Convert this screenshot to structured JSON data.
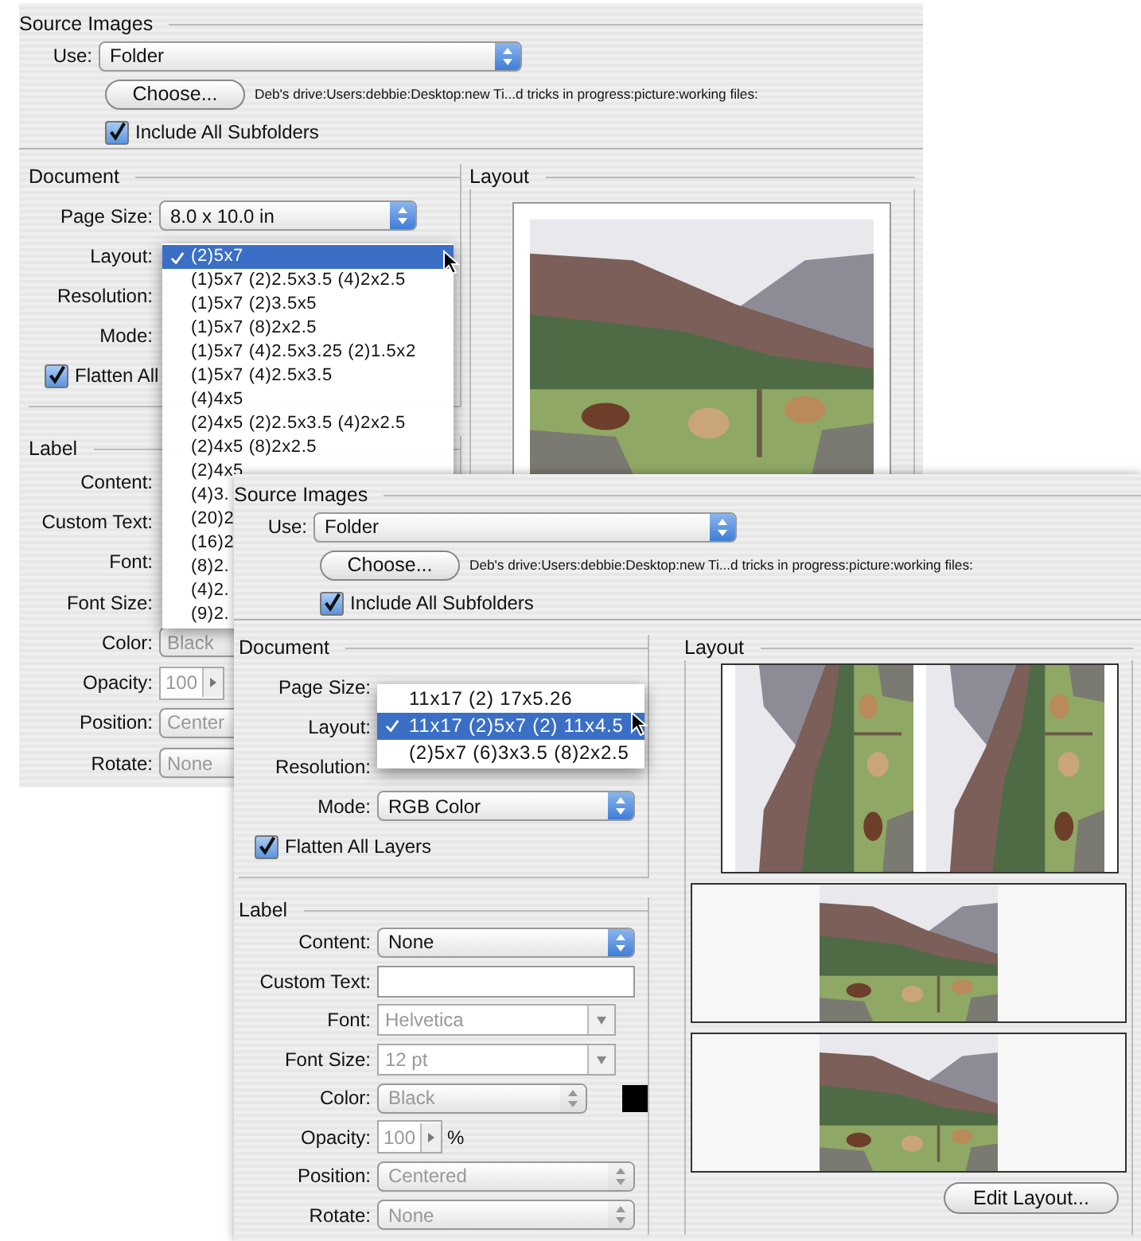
{
  "back_window": {
    "source_images": {
      "title": "Source Images",
      "use": {
        "label": "Use:",
        "value": "Folder"
      },
      "choose_button": "Choose...",
      "path": "Deb's drive:Users:debbie:Desktop:new Ti...d tricks in progress:picture:working files:",
      "include_subfolders": {
        "label": "Include All Subfolders",
        "checked": true
      }
    },
    "document": {
      "title": "Document",
      "rows": [
        {
          "kind": "popup",
          "label": "Page Size:",
          "value": "8.0 x 10.0 in",
          "disabled": false
        },
        {
          "kind": "label",
          "label": "Layout:"
        },
        {
          "kind": "label",
          "label": "Resolution:"
        },
        {
          "kind": "label",
          "label": "Mode:"
        }
      ],
      "flatten": {
        "label": "Flatten All",
        "checked": true
      }
    },
    "layout_menu": [
      {
        "label": "(2)5x7",
        "selected": true
      },
      {
        "label": "(1)5x7 (2)2.5x3.5 (4)2x2.5",
        "selected": false
      },
      {
        "label": "(1)5x7 (2)3.5x5",
        "selected": false
      },
      {
        "label": "(1)5x7 (8)2x2.5",
        "selected": false
      },
      {
        "label": "(1)5x7 (4)2.5x3.25 (2)1.5x2",
        "selected": false
      },
      {
        "label": "(1)5x7 (4)2.5x3.5",
        "selected": false
      },
      {
        "label": "(4)4x5",
        "selected": false
      },
      {
        "label": "(2)4x5 (2)2.5x3.5 (4)2x2.5",
        "selected": false
      },
      {
        "label": "(2)4x5 (8)2x2.5",
        "selected": false
      },
      {
        "label": "(2)4x5",
        "selected": false
      },
      {
        "label": "(4)3.",
        "selected": false
      },
      {
        "label": "(20)2",
        "selected": false
      },
      {
        "label": "(16)2",
        "selected": false
      },
      {
        "label": "(8)2.",
        "selected": false
      },
      {
        "label": "(4)2.",
        "selected": false
      },
      {
        "label": "(9)2.",
        "selected": false
      }
    ],
    "label": {
      "title": "Label",
      "rows": [
        {
          "kind": "label",
          "label": "Content:"
        },
        {
          "kind": "label",
          "label": "Custom Text:"
        },
        {
          "kind": "label",
          "label": "Font:"
        },
        {
          "kind": "label",
          "label": "Font Size:"
        },
        {
          "kind": "popup",
          "label": "Color:",
          "value": "Black",
          "disabled": true
        },
        {
          "kind": "stepper",
          "label": "Opacity:",
          "value": "100",
          "disabled": true
        },
        {
          "kind": "popup",
          "label": "Position:",
          "value": "Center",
          "disabled": true
        },
        {
          "kind": "popup",
          "label": "Rotate:",
          "value": "None",
          "disabled": true
        }
      ]
    },
    "layout_panel": {
      "title": "Layout"
    }
  },
  "front_window": {
    "source_images": {
      "title": "Source Images",
      "use": {
        "label": "Use:",
        "value": "Folder"
      },
      "choose_button": "Choose...",
      "path": "Deb's drive:Users:debbie:Desktop:new Ti...d tricks in progress:picture:working files:",
      "include_subfolders": {
        "label": "Include All Subfolders",
        "checked": true
      }
    },
    "document": {
      "title": "Document",
      "rows": [
        {
          "kind": "label",
          "label": "Page Size:"
        },
        {
          "kind": "label",
          "label": "Layout:"
        },
        {
          "kind": "label",
          "label": "Resolution:"
        },
        {
          "kind": "popup",
          "label": "Mode:",
          "value": "RGB Color",
          "disabled": false
        }
      ],
      "flatten": {
        "label": "Flatten All Layers",
        "checked": true
      }
    },
    "layout_menu": [
      {
        "label": "11x17 (2) 17x5.26",
        "selected": false
      },
      {
        "label": "11x17 (2)5x7 (2) 11x4.5",
        "selected": true
      },
      {
        "label": "(2)5x7 (6)3x3.5 (8)2x2.5",
        "selected": false
      }
    ],
    "label": {
      "title": "Label",
      "rows": [
        {
          "kind": "popup",
          "label": "Content:",
          "value": "None",
          "disabled": false
        },
        {
          "kind": "text",
          "label": "Custom Text:"
        },
        {
          "kind": "combo",
          "label": "Font:",
          "value": "Helvetica",
          "disabled": true
        },
        {
          "kind": "combo",
          "label": "Font Size:",
          "value": "12 pt",
          "disabled": true
        },
        {
          "kind": "popup",
          "label": "Color:",
          "value": "Black",
          "disabled": true,
          "swatch": true
        },
        {
          "kind": "stepper",
          "label": "Opacity:",
          "value": "100",
          "unit": "%",
          "disabled": true
        },
        {
          "kind": "popup",
          "label": "Position:",
          "value": "Centered",
          "disabled": true
        },
        {
          "kind": "popup",
          "label": "Rotate:",
          "value": "None",
          "disabled": true
        }
      ]
    },
    "layout_panel": {
      "title": "Layout",
      "edit_button": "Edit Layout..."
    }
  }
}
